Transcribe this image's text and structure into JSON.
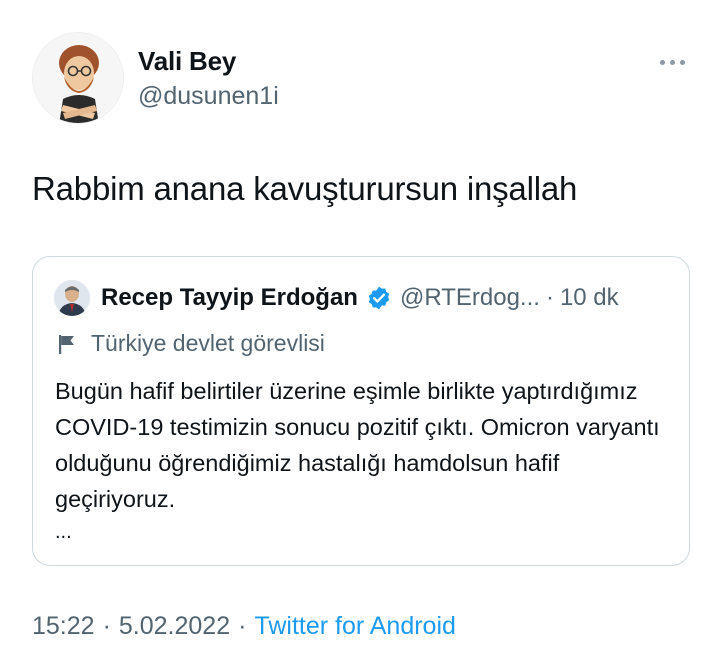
{
  "author": {
    "name": "Vali Bey",
    "handle": "@dusunen1i",
    "avatar_icon": "cartoon-bearded-man-avatar"
  },
  "tweet": {
    "text": "Rabbim anana kavuşturursun inşallah"
  },
  "more_icon": "more-dots-icon",
  "quoted": {
    "name": "Recep Tayyip Erdoğan",
    "verified_icon": "verified-badge-icon",
    "handle": "@RTErdog...",
    "separator": "·",
    "time": "10 dk",
    "label_icon": "flag-icon",
    "label": "Türkiye devlet görevlisi",
    "body": "Bugün hafif belirtiler üzerine eşimle birlikte yaptırdığımız COVID-19 testimizin sonucu pozitif çıktı. Omicron varyantı olduğunu öğrendiğimiz hastalığı hamdolsun hafif geçiriyoruz.",
    "ellipsis": "..."
  },
  "meta": {
    "time": "15:22",
    "separator": "·",
    "date": "5.02.2022",
    "source": "Twitter for Android"
  },
  "colors": {
    "text": "#0f1419",
    "secondary": "#536471",
    "link": "#1d9bf0",
    "border": "#cfd9de",
    "verified": "#1d9bf0"
  }
}
